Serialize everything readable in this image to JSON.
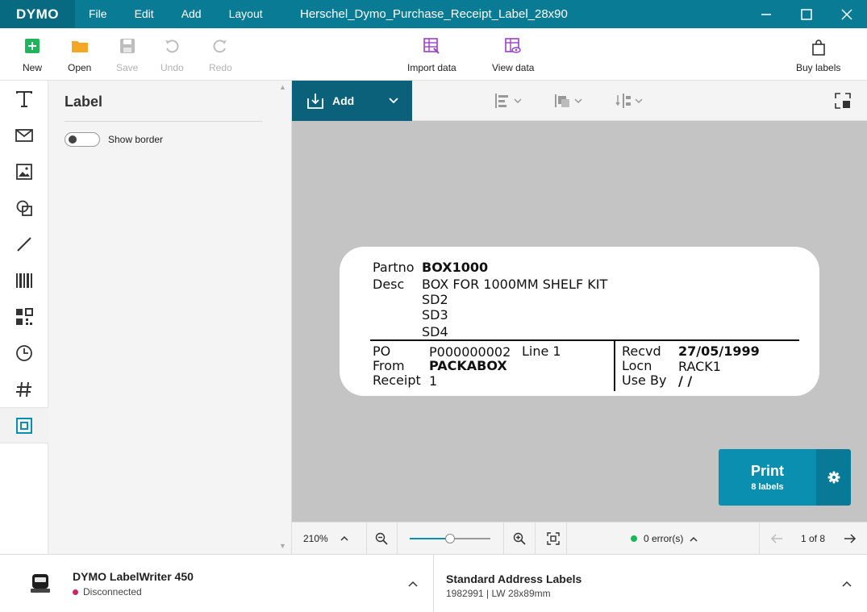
{
  "app": {
    "logo": "DYMO",
    "menu": [
      "File",
      "Edit",
      "Add",
      "Layout"
    ],
    "doc_title": "Herschel_Dymo_Purchase_Receipt_Label_28x90"
  },
  "toolbar": {
    "new": "New",
    "open": "Open",
    "save": "Save",
    "undo": "Undo",
    "redo": "Redo",
    "import_data": "Import data",
    "view_data": "View data",
    "buy_labels": "Buy labels"
  },
  "panel": {
    "title": "Label",
    "show_border": "Show border"
  },
  "canvas_toolbar": {
    "add": "Add"
  },
  "label": {
    "partno_key": "Partno",
    "partno_val": "BOX1000",
    "desc_key": "Desc",
    "desc_lines": [
      "BOX FOR 1000MM SHELF KIT",
      "SD2",
      "SD3",
      "SD4"
    ],
    "po_key": "PO",
    "po_val": "P000000002",
    "line_val": "Line 1",
    "from_key": "From",
    "from_val": "PACKABOX",
    "receipt_key": "Receipt",
    "receipt_val": "1",
    "recvd_key": "Recvd",
    "recvd_val": "27/05/1999",
    "locn_key": "Locn",
    "locn_val": "RACK1",
    "useby_key": "Use By",
    "useby_val": "/ /"
  },
  "print": {
    "label": "Print",
    "count": "8 labels"
  },
  "zoom": {
    "value": "210%",
    "slider_fraction": 0.5,
    "errors": "0 error(s)",
    "page": "1 of 8"
  },
  "status": {
    "printer_name": "DYMO LabelWriter 450",
    "printer_status": "Disconnected",
    "label_type": "Standard Address Labels",
    "label_sku": "1982991  |  LW 28x89mm"
  },
  "colors": {
    "brand": "#0a7b95",
    "print": "#0a8fb0",
    "ok": "#1bb55c",
    "disconnected": "#d0245c"
  }
}
